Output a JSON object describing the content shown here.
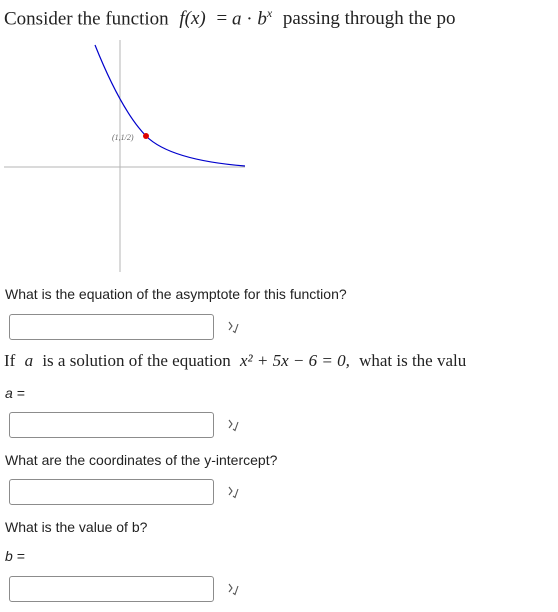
{
  "intro": {
    "prefix": "Consider the function",
    "function_lhs": "f(x)",
    "equals": "=",
    "a": "a",
    "dot": "·",
    "b": "b",
    "exp": "x",
    "suffix": "passing through the po"
  },
  "graph": {
    "point_label": "(1,1/2)",
    "curve_color": "#0000cc",
    "point_color": "#dd0000"
  },
  "questions": {
    "asymptote": "What is the equation of the asymptote for this function?",
    "solution_prefix": "If",
    "solution_var": "a",
    "solution_mid": "is a solution of the equation",
    "solution_eq": "x² + 5x − 6 = 0,",
    "solution_suffix": "what is the valu",
    "a_label": "a =",
    "y_intercept": "What are the coordinates of the y-intercept?",
    "b_value": "What is the value of b?",
    "b_label": "b ="
  },
  "inputs": {
    "asymptote_value": "",
    "a_value": "",
    "y_intercept_value": "",
    "b_value": ""
  }
}
